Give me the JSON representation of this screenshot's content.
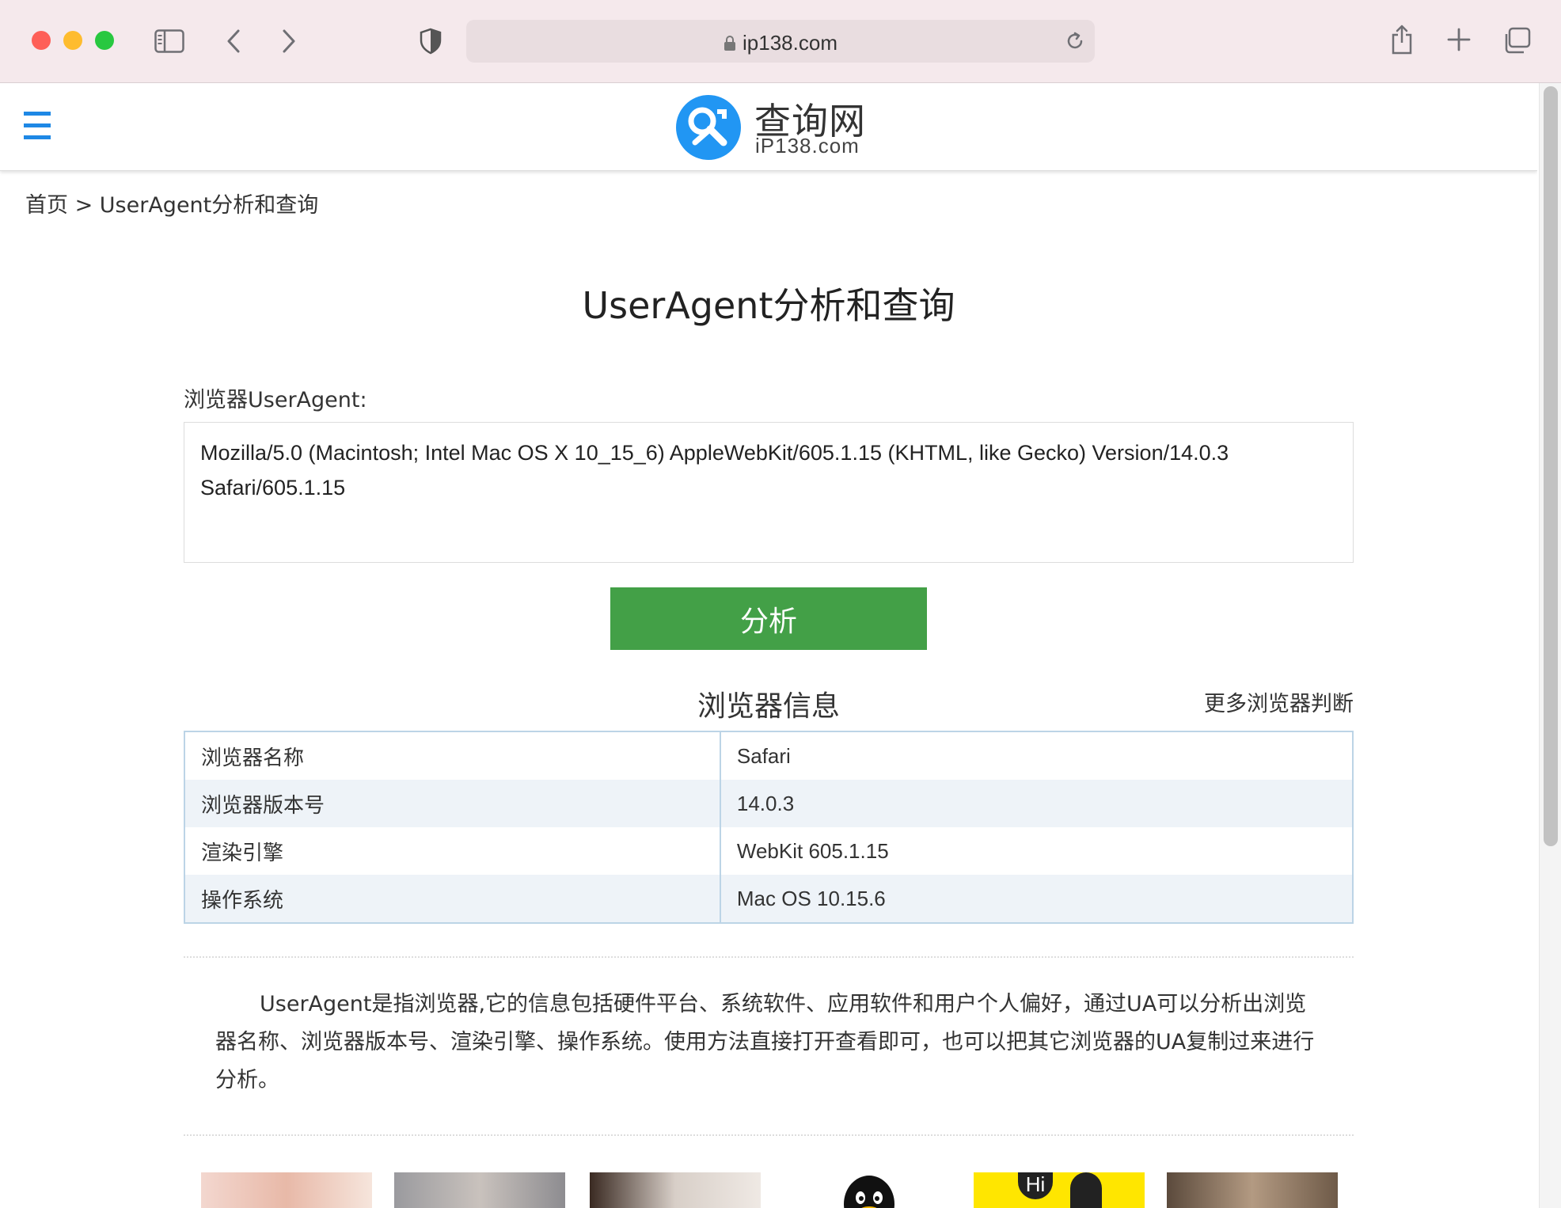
{
  "browser": {
    "url": "ip138.com",
    "colors": {
      "close": "#fe5f57",
      "minimize": "#febc2e",
      "maximize": "#28c840"
    },
    "icons": [
      "sidebar-icon",
      "back-icon",
      "forward-icon",
      "shield-icon",
      "lock-icon",
      "reload-icon",
      "share-icon",
      "new-tab-icon",
      "tabs-overview-icon"
    ]
  },
  "site": {
    "logo_cn": "查询网",
    "logo_en": "iP138.com",
    "brand_color": "#2196f3"
  },
  "breadcrumb": {
    "home": "首页",
    "separator": " > ",
    "current": "UserAgent分析和查询"
  },
  "main": {
    "title": "UserAgent分析和查询",
    "ua_label": "浏览器UserAgent:",
    "ua_value": "Mozilla/5.0 (Macintosh; Intel Mac OS X 10_15_6) AppleWebKit/605.1.15 (KHTML, like Gecko) Version/14.0.3 Safari/605.1.15",
    "analyze_label": "分析",
    "analyze_color": "#43a047",
    "info_title": "浏览器信息",
    "more_link": "更多浏览器判断",
    "rows": [
      {
        "label": "浏览器名称",
        "value": "Safari"
      },
      {
        "label": "浏览器版本号",
        "value": "14.0.3"
      },
      {
        "label": "渲染引擎",
        "value": "WebKit 605.1.15"
      },
      {
        "label": "操作系统",
        "value": "Mac OS 10.15.6"
      }
    ],
    "description": "UserAgent是指浏览器,它的信息包括硬件平台、系统软件、应用软件和用户个人偏好，通过UA可以分析出浏览器名称、浏览器版本号、渲染引擎、操作系统。使用方法直接打开查看即可，也可以把其它浏览器的UA复制过来进行分析。"
  },
  "thumbnails": {
    "hi_text": "Hi"
  }
}
